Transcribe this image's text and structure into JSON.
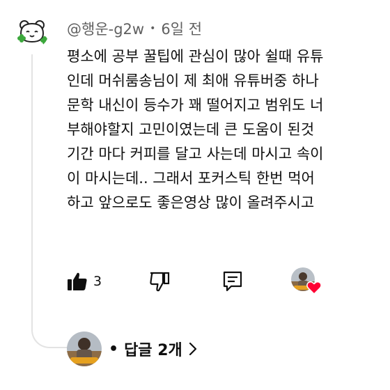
{
  "comment": {
    "author": "@행운-g2w",
    "separator": "•",
    "time": "6일 전",
    "lines": [
      "평소에 공부 꿀팁에 관심이 많아 쉴때 유튜",
      "인데 머쉬룸송님이 제 최애 유튜버중 하나",
      "문학 내신이 등수가 꽤 떨어지고 범위도 너",
      "부해야할지 고민이였는데 큰 도움이 된것",
      "기간 마다 커피를 달고 사는데 마시고 속이",
      "이 마시는데.. 그래서 포커스틱 한번 먹어",
      "하고 앞으로도 좋은영상 많이 올려주시고"
    ]
  },
  "actions": {
    "like_icon": "thumbs-up-filled-icon",
    "like_count": "3",
    "dislike_icon": "thumbs-down-icon",
    "reply_icon": "comment-icon",
    "heart_icon": "heart-icon",
    "heart_color": "#ff0033"
  },
  "replies": {
    "bullet": "•",
    "label": "답글 2개",
    "chevron_icon": "chevron-right-icon"
  }
}
